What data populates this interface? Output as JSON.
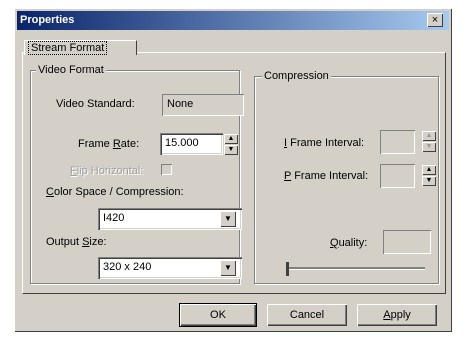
{
  "window": {
    "title": "Properties",
    "close": "×"
  },
  "tabs": [
    {
      "label": "Stream Format"
    }
  ],
  "video_format": {
    "legend": "Video Format",
    "video_standard_label": "Video Standard:",
    "video_standard_value": "None",
    "frame_rate_label": "Frame Rate:",
    "frame_rate_value": "15.000",
    "flip_horizontal_label": "Flip Horizontal:",
    "color_space_label": "Color Space / Compression:",
    "color_space_value": "I420",
    "output_size_label": "Output Size:",
    "output_size_value": "320 x 240"
  },
  "compression": {
    "legend": "Compression",
    "i_frame_label": "I Frame Interval:",
    "p_frame_label": "P Frame Interval:",
    "quality_label": "Quality:"
  },
  "buttons": {
    "ok": "OK",
    "cancel": "Cancel",
    "apply": "Apply"
  }
}
